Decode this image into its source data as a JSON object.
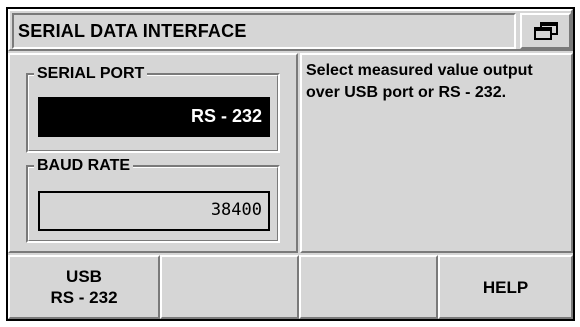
{
  "title_bar": {
    "title": "SERIAL DATA INTERFACE",
    "window_icon": "windows-stack-icon"
  },
  "serial_port": {
    "label": "SERIAL PORT",
    "value": "RS - 232"
  },
  "baud_rate": {
    "label": "BAUD RATE",
    "value": "38400"
  },
  "help": {
    "text": "Select measured value output over USB port or RS - 232."
  },
  "softkeys": [
    {
      "line1": "USB",
      "line2": "RS - 232"
    },
    {
      "line1": "",
      "line2": ""
    },
    {
      "line1": "",
      "line2": ""
    },
    {
      "line1": "HELP",
      "line2": ""
    }
  ],
  "colors": {
    "background": "#d6d6d6",
    "selected_field": "#000000",
    "selected_text": "#ffffff"
  }
}
